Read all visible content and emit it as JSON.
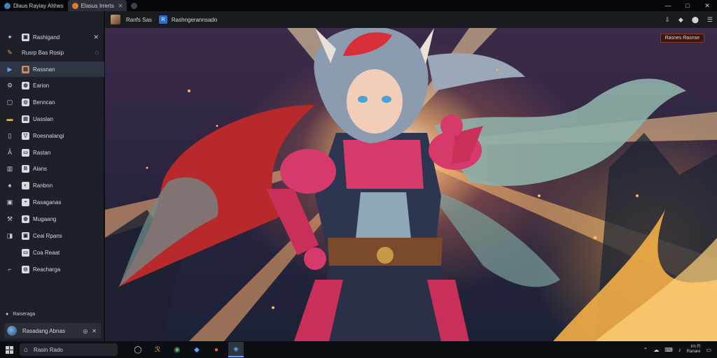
{
  "titlebar": {
    "tabs": [
      {
        "label": "Dlaus Rayiay Ahhes",
        "active": false,
        "icon": "app-icon"
      },
      {
        "label": "Elasus Irrerts",
        "active": true,
        "icon": "fox-icon"
      },
      {
        "label": "",
        "active": false,
        "icon": "globe-icon"
      }
    ],
    "controls": {
      "minimize": "—",
      "maximize": "□",
      "close": "✕"
    }
  },
  "sidebar": {
    "items": [
      {
        "icon": "gear-icon",
        "sub": "▣",
        "label": "Rashigand",
        "end": "✕",
        "active": false
      },
      {
        "icon": "pencil-icon",
        "sub": "",
        "label": "Rusrp Bas Rosip",
        "end": "◌",
        "active": false
      },
      {
        "icon": "play-icon",
        "sub": "▤",
        "label": "Rassnan",
        "end": "",
        "active": true
      },
      {
        "icon": "settings-icon",
        "sub": "◍",
        "label": "Earion",
        "end": "",
        "active": false
      },
      {
        "icon": "square-icon",
        "sub": "◎",
        "label": "Benncan",
        "end": "",
        "active": false
      },
      {
        "icon": "folder-icon",
        "sub": "▤",
        "label": "Uasslan",
        "end": "",
        "active": false
      },
      {
        "icon": "chat-icon",
        "sub": "▽",
        "label": "Roesnalangi",
        "end": "",
        "active": false
      },
      {
        "icon": "user-icon",
        "sub": "▭",
        "label": "Rastan",
        "end": "",
        "active": false
      },
      {
        "icon": "grid-icon",
        "sub": "B",
        "label": "Alans",
        "end": "",
        "active": false
      },
      {
        "icon": "bell-icon",
        "sub": "◐",
        "label": "Ranbnn",
        "end": "",
        "active": false
      },
      {
        "icon": "image-icon",
        "sub": "◓",
        "label": "Rasaganas",
        "end": "",
        "active": false
      },
      {
        "icon": "tools-icon",
        "sub": "◍",
        "label": "Mugaang",
        "end": "",
        "active": false
      },
      {
        "icon": "tag-icon",
        "sub": "▣",
        "label": "Ceai Rpans",
        "end": "",
        "active": false
      },
      {
        "icon": "",
        "sub": "▭",
        "label": "Coa Reaat",
        "end": "",
        "active": false
      },
      {
        "icon": "link-icon",
        "sub": "◎",
        "label": "Reacharga",
        "end": "",
        "active": false
      }
    ],
    "status": "Raiseraga",
    "user": {
      "name": "Rasadang Abnas",
      "icons": [
        "◎",
        "✕"
      ]
    }
  },
  "toolbar": {
    "text": "Ranfs Sas",
    "badge": "R",
    "title": "Rashngerannsado",
    "right_icons": [
      "⇩",
      "◆",
      "⬤",
      "☰"
    ]
  },
  "viewer": {
    "badge": "Rasnes Rasnse"
  },
  "taskbar": {
    "search_text": "Rasin Rado",
    "apps": [
      "◯",
      "ℛ",
      "◉",
      "◆",
      "●",
      "◈"
    ],
    "tray_icons": [
      "⌃",
      "☁",
      "⌨",
      "♪"
    ],
    "clock_time": "Irn Fl",
    "clock_date": "Ranare",
    "notification": "▭"
  },
  "colors": {
    "accent": "#2d6fd2",
    "sidebar_bg": "#1d2127",
    "titlebar_bg": "#05070a"
  }
}
